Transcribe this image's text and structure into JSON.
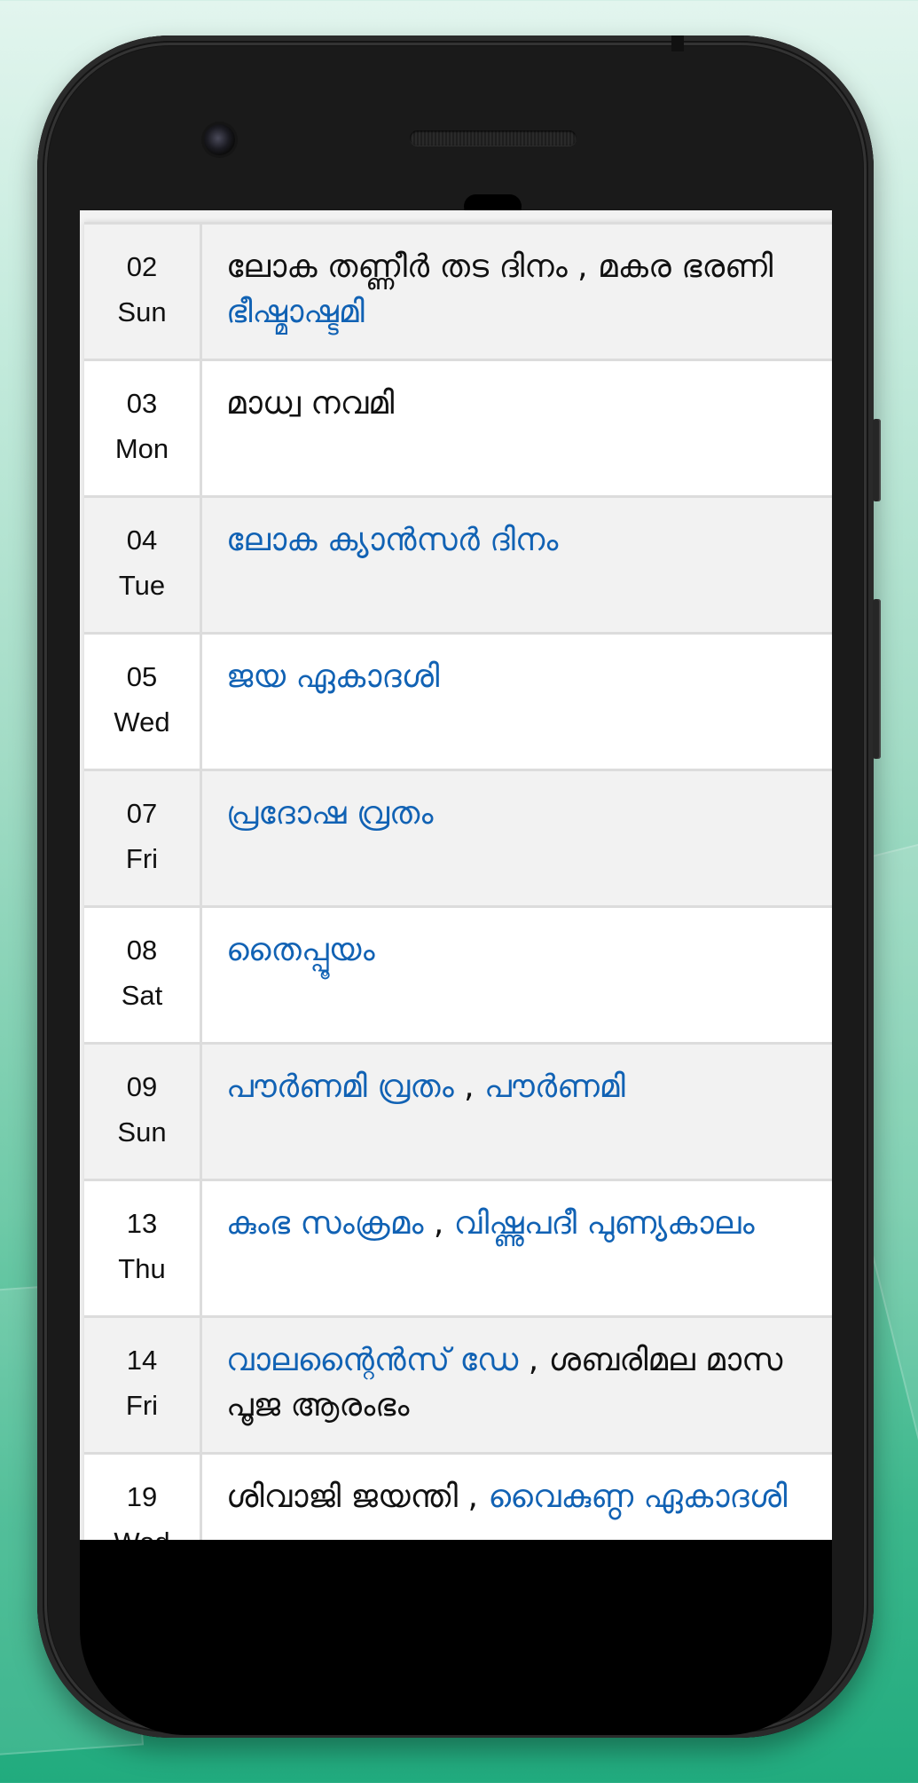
{
  "device": {
    "type": "phone",
    "background_colors": [
      "#e2f5ee",
      "#a3dcc6",
      "#21ab7e"
    ]
  },
  "colors": {
    "holiday_link": "#1162b4",
    "normal_text": "#111111",
    "row_alt": "#f2f2f2",
    "row": "#ffffff",
    "divider": "#dcdcdc"
  },
  "rows": [
    {
      "day": "02",
      "weekday": "Sun",
      "lines": [
        [
          {
            "text": "ലോക തണ്ണീർ തട ദിനം",
            "color": "black"
          },
          {
            "text": " , ",
            "color": "sep"
          },
          {
            "text": "മകര ഭരണി",
            "color": "black"
          }
        ],
        [
          {
            "text": "ഭീഷ്മാഷ്ടമി",
            "color": "blue"
          }
        ]
      ]
    },
    {
      "day": "03",
      "weekday": "Mon",
      "lines": [
        [
          {
            "text": "മാധ്വ നവമി",
            "color": "black"
          }
        ]
      ]
    },
    {
      "day": "04",
      "weekday": "Tue",
      "lines": [
        [
          {
            "text": "ലോക ക്യാൻസർ ദിനം",
            "color": "blue"
          }
        ]
      ]
    },
    {
      "day": "05",
      "weekday": "Wed",
      "lines": [
        [
          {
            "text": "ജയ ഏകാദശി",
            "color": "blue"
          }
        ]
      ]
    },
    {
      "day": "07",
      "weekday": "Fri",
      "lines": [
        [
          {
            "text": "പ്രദോഷ വ്രതം",
            "color": "blue"
          }
        ]
      ]
    },
    {
      "day": "08",
      "weekday": "Sat",
      "lines": [
        [
          {
            "text": "തൈപ്പൂയം",
            "color": "blue"
          }
        ]
      ]
    },
    {
      "day": "09",
      "weekday": "Sun",
      "lines": [
        [
          {
            "text": "പൗർണമി വ്രതം",
            "color": "blue"
          },
          {
            "text": " , ",
            "color": "sep"
          },
          {
            "text": "പൗർണമി",
            "color": "blue"
          }
        ]
      ]
    },
    {
      "day": "13",
      "weekday": "Thu",
      "lines": [
        [
          {
            "text": "കുംഭ സംക്രമം",
            "color": "blue"
          },
          {
            "text": " , ",
            "color": "sep"
          },
          {
            "text": "വിഷ്ണുപദീ പുണ്യകാലം",
            "color": "blue"
          }
        ]
      ]
    },
    {
      "day": "14",
      "weekday": "Fri",
      "lines": [
        [
          {
            "text": "വാലന്റൈൻസ് ഡേ",
            "color": "blue"
          },
          {
            "text": " , ",
            "color": "sep"
          },
          {
            "text": "ശബരിമല മാസ",
            "color": "black"
          }
        ],
        [
          {
            "text": "പൂജ ആരംഭം",
            "color": "black"
          }
        ]
      ]
    },
    {
      "day": "19",
      "weekday": "Wed",
      "lines": [
        [
          {
            "text": "ശിവാജി ജയന്തി",
            "color": "black"
          },
          {
            "text": " , ",
            "color": "sep"
          },
          {
            "text": "വൈകുണ്ഠ ഏകാദശി",
            "color": "blue"
          }
        ]
      ]
    }
  ]
}
